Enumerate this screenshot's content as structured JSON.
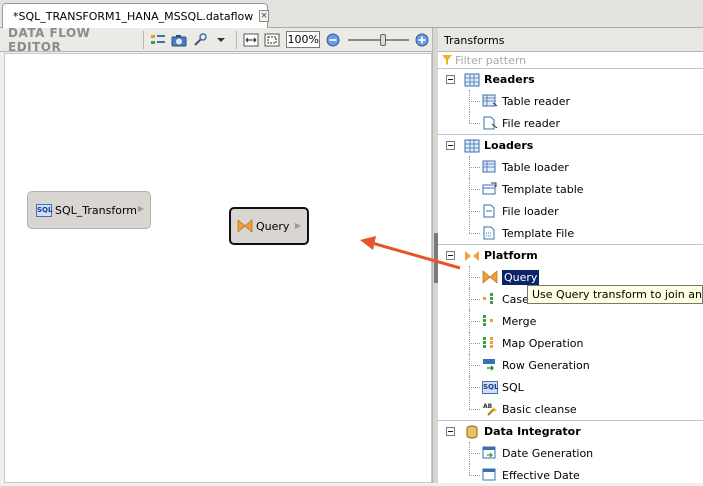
{
  "tab": {
    "title": "*SQL_TRANSFORM1_HANA_MSSQL.dataflow",
    "close": "×"
  },
  "editor": {
    "title": "DATA FLOW EDITOR",
    "zoom": "100%"
  },
  "canvas": {
    "nodes": [
      {
        "label": "SQL_Transform",
        "icon": "sql-icon"
      },
      {
        "label": "Query",
        "icon": "query-icon"
      }
    ]
  },
  "panel": {
    "title": "Transforms",
    "filter_placeholder": "Filter pattern",
    "groups": [
      {
        "label": "Readers",
        "items": [
          "Table reader",
          "File reader"
        ]
      },
      {
        "label": "Loaders",
        "items": [
          "Table loader",
          "Template table",
          "File loader",
          "Template File"
        ]
      },
      {
        "label": "Platform",
        "items": [
          "Query",
          "Case",
          "Merge",
          "Map Operation",
          "Row Generation",
          "SQL",
          "Basic cleanse"
        ]
      },
      {
        "label": "Data Integrator",
        "items": [
          "Date Generation",
          "Effective Date"
        ]
      }
    ],
    "selected_item": "Query"
  },
  "tooltip": "Use Query transform to join and filt",
  "colors": {
    "selection": "#0a246a",
    "arrow": "#e8542a",
    "tooltip_bg": "#ffffe1"
  }
}
